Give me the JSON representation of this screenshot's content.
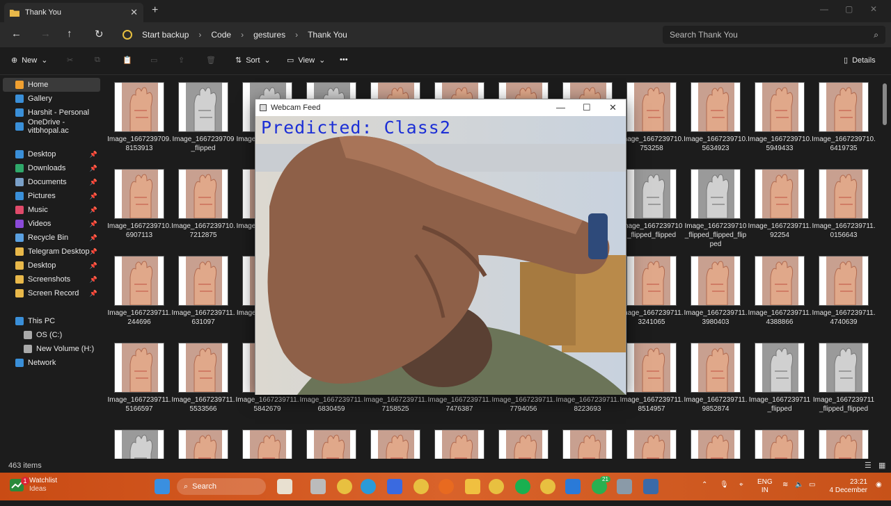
{
  "window": {
    "tab_title": "Thank You",
    "tab_close": "✕",
    "new_tab": "+"
  },
  "address": {
    "breadcrumbs": [
      "Start backup",
      "Code",
      "gestures",
      "Thank You"
    ],
    "search_placeholder": "Search Thank You"
  },
  "commandbar": {
    "new_label": "New",
    "sort_label": "Sort",
    "view_label": "View",
    "more": "•••",
    "details_label": "Details"
  },
  "sidebar": {
    "items": [
      {
        "label": "Home",
        "icon": "home-icon",
        "color": "#f0a030"
      },
      {
        "label": "Gallery",
        "icon": "gallery-icon",
        "color": "#3a8fd8"
      },
      {
        "label": "Harshit - Personal",
        "icon": "cloud-icon",
        "color": "#3a8fd8"
      },
      {
        "label": "OneDrive - vitbhopal.ac",
        "icon": "cloud-icon",
        "color": "#3a8fd8"
      },
      {
        "label": "Desktop",
        "icon": "desktop-icon",
        "color": "#3a8fd8",
        "pinned": true
      },
      {
        "label": "Downloads",
        "icon": "download-icon",
        "color": "#2fa86a",
        "pinned": true
      },
      {
        "label": "Documents",
        "icon": "document-icon",
        "color": "#7aa0c8",
        "pinned": true
      },
      {
        "label": "Pictures",
        "icon": "picture-icon",
        "color": "#3a8fd8",
        "pinned": true
      },
      {
        "label": "Music",
        "icon": "music-icon",
        "color": "#e04a6a",
        "pinned": true
      },
      {
        "label": "Videos",
        "icon": "video-icon",
        "color": "#8a4ad8",
        "pinned": true
      },
      {
        "label": "Recycle Bin",
        "icon": "recycle-bin-icon",
        "color": "#5aa0e0",
        "pinned": true
      },
      {
        "label": "Telegram Desktop",
        "icon": "folder-icon",
        "color": "#e8b84a",
        "pinned": true
      },
      {
        "label": "Desktop",
        "icon": "folder-icon",
        "color": "#e8b84a",
        "pinned": true
      },
      {
        "label": "Screenshots",
        "icon": "folder-icon",
        "color": "#e8b84a",
        "pinned": true
      },
      {
        "label": "Screen Record",
        "icon": "folder-icon",
        "color": "#e8b84a",
        "pinned": true
      },
      {
        "label": "This PC",
        "icon": "pc-icon",
        "color": "#3a8fd8"
      },
      {
        "label": "OS (C:)",
        "icon": "drive-icon",
        "color": "#aaaaaa"
      },
      {
        "label": "New Volume (H:)",
        "icon": "drive-icon",
        "color": "#aaaaaa"
      },
      {
        "label": "Network",
        "icon": "network-icon",
        "color": "#3a8fd8"
      }
    ]
  },
  "files": [
    [
      "Image_1667239709.8153913",
      "Image_1667239709_flipped",
      "Image_1667239709_f",
      "",
      "",
      "",
      "",
      "",
      "Image_1667239710.753258",
      "Image_1667239710.5634923",
      "Image_1667239710.5949433",
      "Image_1667239710.6419735"
    ],
    [
      "Image_1667239710.6907113",
      "Image_1667239710.7212875",
      "Image_1667239710",
      "",
      "",
      "",
      "",
      "",
      "Image_1667239710_flipped_flipped",
      "Image_1667239710_flipped_flipped_flipped",
      "Image_1667239711.92254",
      "Image_1667239711.0156643"
    ],
    [
      "Image_1667239711.244696",
      "Image_1667239711.631097",
      "Image_1667239711",
      "",
      "",
      "",
      "",
      "",
      "Image_1667239711.3241065",
      "Image_1667239711.3980403",
      "Image_1667239711.4388866",
      "Image_1667239711.4740639"
    ],
    [
      "Image_1667239711.5166597",
      "Image_1667239711.5533566",
      "Image_1667239711.5842679",
      "Image_1667239711.6830459",
      "Image_1667239711.7158525",
      "Image_1667239711.7476387",
      "Image_1667239711.7794056",
      "Image_1667239711.8223693",
      "Image_1667239711.8514957",
      "Image_1667239711.9852874",
      "Image_1667239711_flipped",
      "Image_1667239711_flipped_flipped"
    ],
    [
      "",
      "",
      "",
      "",
      "",
      "",
      "",
      "",
      "",
      "",
      "",
      ""
    ]
  ],
  "grayscale_cells": [
    [
      0,
      1
    ],
    [
      0,
      2
    ],
    [
      0,
      3
    ],
    [
      1,
      8
    ],
    [
      1,
      9
    ],
    [
      3,
      10
    ],
    [
      3,
      11
    ],
    [
      4,
      0
    ]
  ],
  "status": {
    "item_count": "463 items"
  },
  "webcam": {
    "title": "Webcam Feed",
    "prediction": "Predicted: Class2",
    "prediction_color": "#1c2fd6"
  },
  "taskbar": {
    "watchlist_title": "Watchlist",
    "watchlist_sub": "Ideas",
    "badge": "1",
    "search_label": "Search",
    "lang_1": "ENG",
    "lang_2": "IN",
    "time": "23:21",
    "date": "4 December",
    "notif_count": "21"
  }
}
